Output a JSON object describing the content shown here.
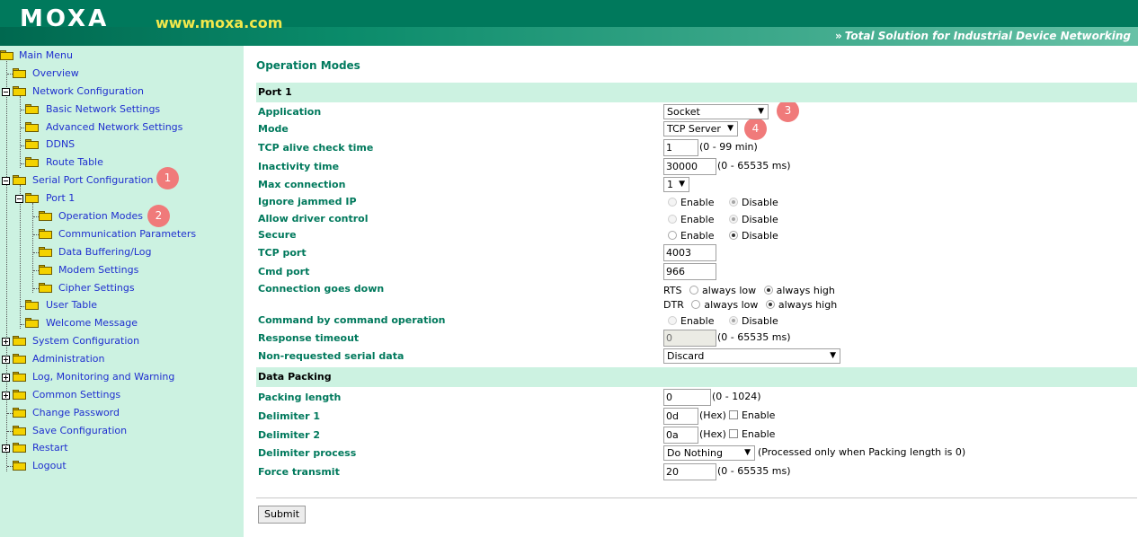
{
  "header": {
    "logo": "MOXA",
    "url": "www.moxa.com",
    "tagline_arrows": "»",
    "tagline": "Total Solution for Industrial Device Networking"
  },
  "sidebar": {
    "items": [
      {
        "label": "Main Menu"
      },
      {
        "label": "Overview"
      },
      {
        "label": "Network Configuration"
      },
      {
        "label": "Basic Network Settings"
      },
      {
        "label": "Advanced Network Settings"
      },
      {
        "label": "DDNS"
      },
      {
        "label": "Route Table"
      },
      {
        "label": "Serial Port Configuration"
      },
      {
        "label": "Port 1"
      },
      {
        "label": "Operation Modes"
      },
      {
        "label": "Communication Parameters"
      },
      {
        "label": "Data Buffering/Log"
      },
      {
        "label": "Modem Settings"
      },
      {
        "label": "Cipher Settings"
      },
      {
        "label": "User Table"
      },
      {
        "label": "Welcome Message"
      },
      {
        "label": "System Configuration"
      },
      {
        "label": "Administration"
      },
      {
        "label": "Log, Monitoring and Warning"
      },
      {
        "label": "Common Settings"
      },
      {
        "label": "Change Password"
      },
      {
        "label": "Save Configuration"
      },
      {
        "label": "Restart"
      },
      {
        "label": "Logout"
      }
    ]
  },
  "badges": [
    "1",
    "2",
    "3",
    "4"
  ],
  "main": {
    "title": "Operation Modes",
    "port_section": "Port 1",
    "data_packing_section": "Data Packing",
    "labels": {
      "application": "Application",
      "mode": "Mode",
      "tcp_alive": "TCP alive check time",
      "inactivity": "Inactivity time",
      "max_connection": "Max connection",
      "ignore_jammed": "Ignore jammed IP",
      "allow_driver": "Allow driver control",
      "secure": "Secure",
      "tcp_port": "TCP port",
      "cmd_port": "Cmd port",
      "conn_down": "Connection goes down",
      "cmd_by_cmd": "Command by command operation",
      "response_timeout": "Response timeout",
      "non_requested": "Non-requested serial data",
      "packing_length": "Packing length",
      "delimiter1": "Delimiter 1",
      "delimiter2": "Delimiter 2",
      "delimiter_process": "Delimiter process",
      "force_transmit": "Force transmit"
    },
    "values": {
      "application": "Socket",
      "mode": "TCP Server",
      "tcp_alive": "1",
      "inactivity": "30000",
      "max_connection": "1",
      "tcp_port": "4003",
      "cmd_port": "966",
      "response_timeout": "0",
      "non_requested": "Discard",
      "packing_length": "0",
      "delimiter1": "0d",
      "delimiter2": "0a",
      "delimiter_process": "Do Nothing",
      "force_transmit": "20"
    },
    "hints": {
      "tcp_alive": "(0 - 99 min)",
      "inactivity": "(0 - 65535 ms)",
      "response_timeout": "(0 - 65535 ms)",
      "packing_length": "(0 - 1024)",
      "hex": "(Hex)",
      "delimiter_process": "(Processed only when Packing length is 0)",
      "force_transmit": "(0 - 65535 ms)"
    },
    "options": {
      "enable": "Enable",
      "disable": "Disable",
      "rts": "RTS",
      "dtr": "DTR",
      "always_low": "always low",
      "always_high": "always high"
    },
    "submit": "Submit"
  }
}
